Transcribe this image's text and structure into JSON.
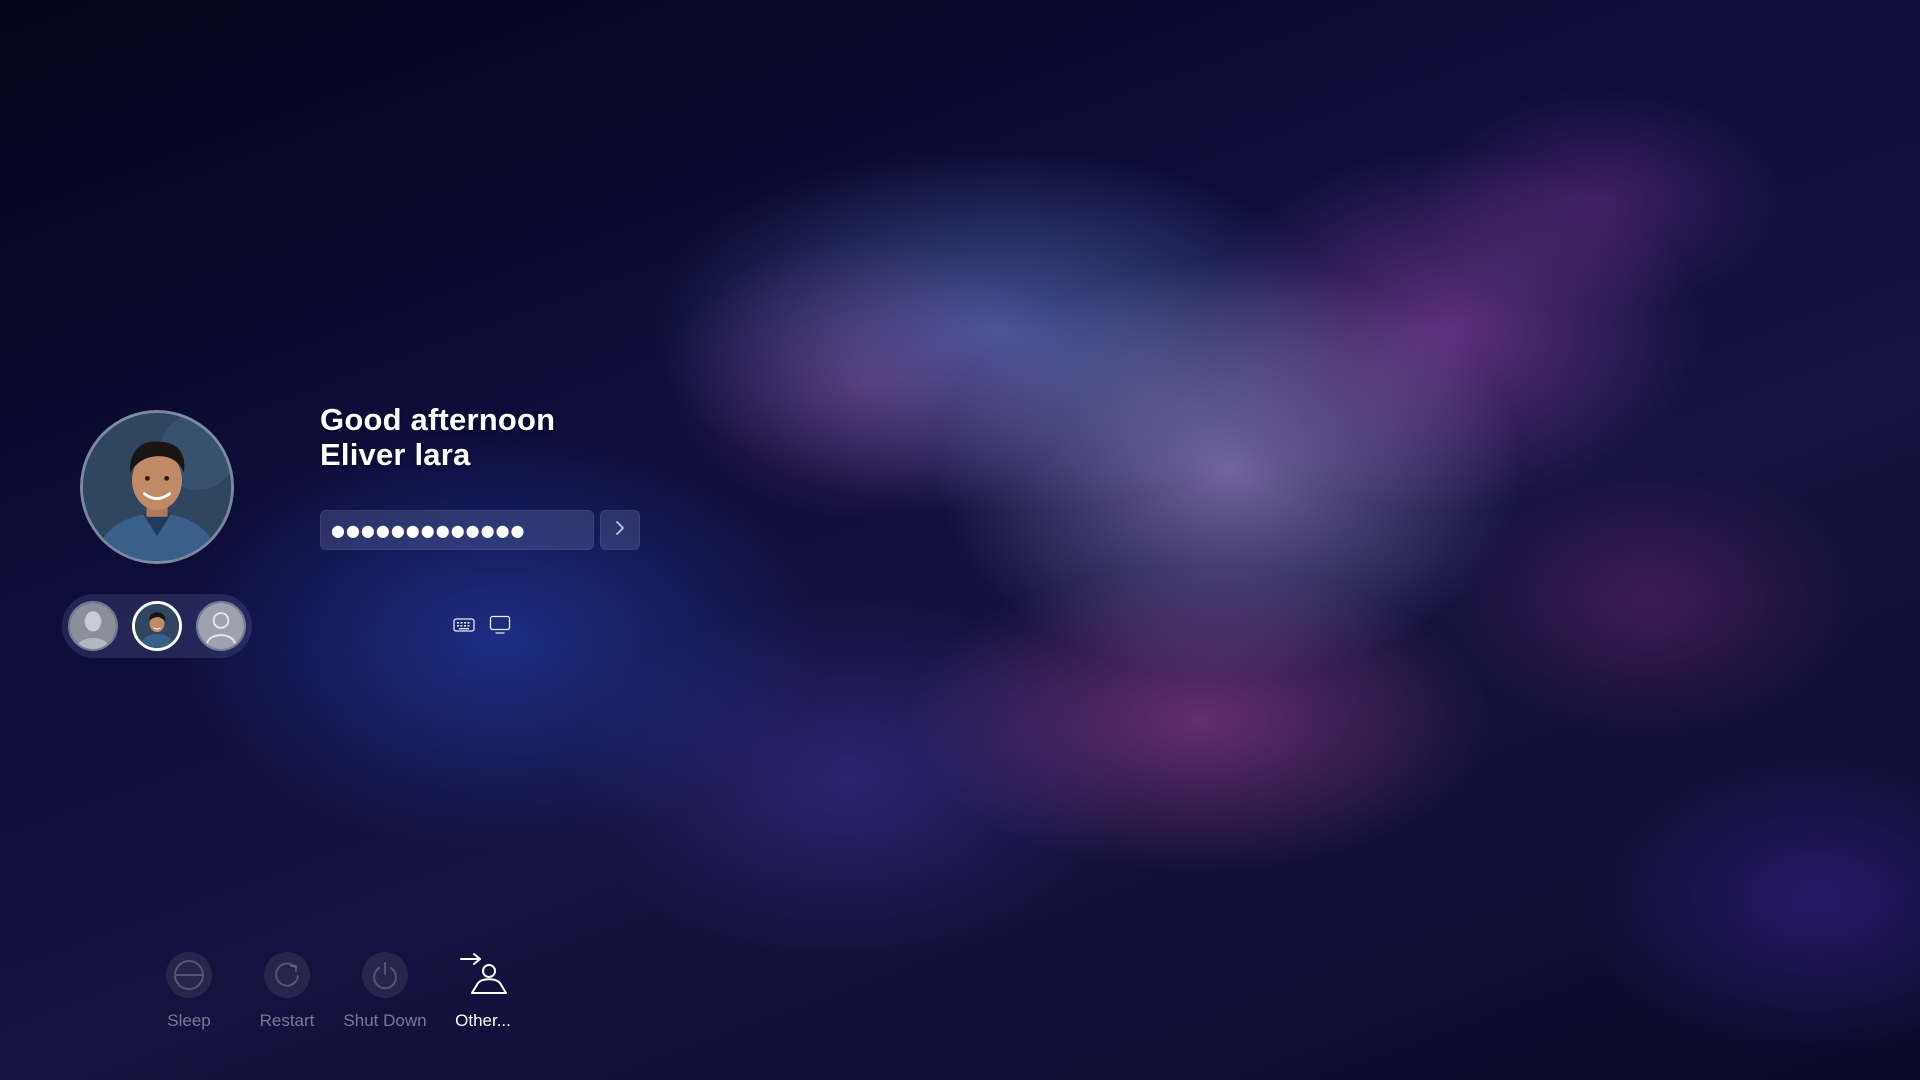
{
  "login": {
    "greeting_line1": "Good afternoon",
    "greeting_line2": "Eliver lara",
    "password_masked": "●●●●●●●●●●●●●",
    "submit_icon": "chevron-right-icon"
  },
  "users": [
    {
      "name": "user-photo-gray",
      "selected": false
    },
    {
      "name": "Eliver lara",
      "selected": true
    },
    {
      "name": "generic-user",
      "selected": false
    }
  ],
  "aux_icons": [
    "keyboard-icon",
    "display-icon"
  ],
  "power": {
    "sleep_label": "Sleep",
    "restart_label": "Restart",
    "shutdown_label": "Shut Down",
    "other_label": "Other..."
  },
  "colors": {
    "accent": "#ffffff",
    "field_bg": "#5a6290",
    "dim_text": "#c8cde1"
  }
}
